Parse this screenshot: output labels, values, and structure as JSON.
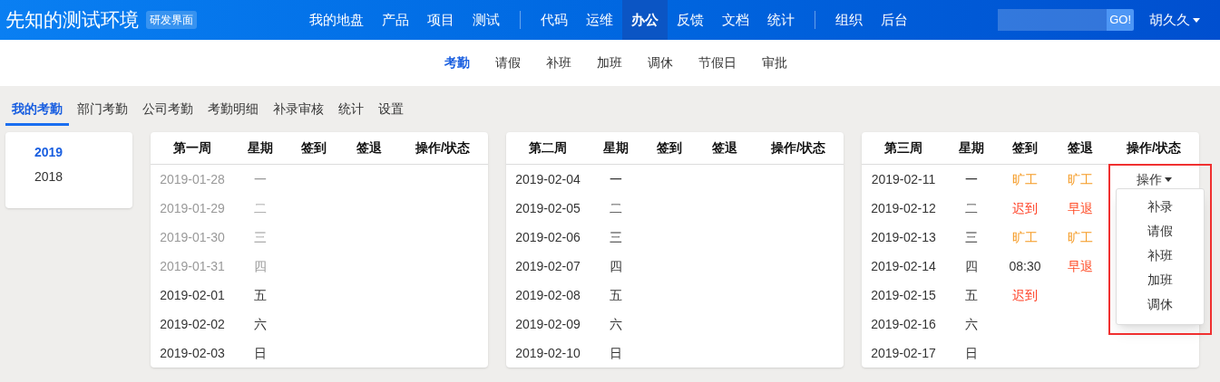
{
  "header": {
    "brand": "先知的测试环境",
    "badge": "研发界面",
    "nav_groups": [
      [
        {
          "label": "我的地盘",
          "selected": false
        },
        {
          "label": "产品",
          "selected": false
        },
        {
          "label": "项目",
          "selected": false
        },
        {
          "label": "测试",
          "selected": false
        }
      ],
      [
        {
          "label": "代码",
          "selected": false
        },
        {
          "label": "运维",
          "selected": false
        },
        {
          "label": "办公",
          "selected": true
        },
        {
          "label": "反馈",
          "selected": false
        },
        {
          "label": "文档",
          "selected": false
        },
        {
          "label": "统计",
          "selected": false
        }
      ],
      [
        {
          "label": "组织",
          "selected": false
        },
        {
          "label": "后台",
          "selected": false
        }
      ]
    ],
    "search_button": "GO!",
    "user": "胡久久"
  },
  "subnav": [
    {
      "label": "考勤",
      "selected": true
    },
    {
      "label": "请假",
      "selected": false
    },
    {
      "label": "补班",
      "selected": false
    },
    {
      "label": "加班",
      "selected": false
    },
    {
      "label": "调休",
      "selected": false
    },
    {
      "label": "节假日",
      "selected": false
    },
    {
      "label": "审批",
      "selected": false
    }
  ],
  "tabs": [
    {
      "label": "我的考勤",
      "selected": true
    },
    {
      "label": "部门考勤",
      "selected": false
    },
    {
      "label": "公司考勤",
      "selected": false
    },
    {
      "label": "考勤明细",
      "selected": false
    },
    {
      "label": "补录审核",
      "selected": false
    },
    {
      "label": "统计",
      "selected": false
    },
    {
      "label": "设置",
      "selected": false
    }
  ],
  "years": [
    {
      "label": "2019",
      "selected": true
    },
    {
      "label": "2018",
      "selected": false
    }
  ],
  "weeks": [
    {
      "columns": [
        "第一周",
        "星期",
        "签到",
        "签退",
        "操作/状态"
      ],
      "rows": [
        {
          "date": "2019-01-28",
          "weekday": "一",
          "muted": true
        },
        {
          "date": "2019-01-29",
          "weekday": "二",
          "muted": true
        },
        {
          "date": "2019-01-30",
          "weekday": "三",
          "muted": true
        },
        {
          "date": "2019-01-31",
          "weekday": "四",
          "muted": true
        },
        {
          "date": "2019-02-01",
          "weekday": "五",
          "muted": false
        },
        {
          "date": "2019-02-02",
          "weekday": "六",
          "muted": false
        },
        {
          "date": "2019-02-03",
          "weekday": "日",
          "muted": false
        }
      ]
    },
    {
      "columns": [
        "第二周",
        "星期",
        "签到",
        "签退",
        "操作/状态"
      ],
      "rows": [
        {
          "date": "2019-02-04",
          "weekday": "一",
          "muted": false
        },
        {
          "date": "2019-02-05",
          "weekday": "二",
          "muted": false
        },
        {
          "date": "2019-02-06",
          "weekday": "三",
          "muted": false
        },
        {
          "date": "2019-02-07",
          "weekday": "四",
          "muted": false
        },
        {
          "date": "2019-02-08",
          "weekday": "五",
          "muted": false
        },
        {
          "date": "2019-02-09",
          "weekday": "六",
          "muted": false
        },
        {
          "date": "2019-02-10",
          "weekday": "日",
          "muted": false
        }
      ]
    },
    {
      "columns": [
        "第三周",
        "星期",
        "签到",
        "签退",
        "操作/状态"
      ],
      "rows": [
        {
          "date": "2019-02-11",
          "weekday": "一",
          "muted": false,
          "check_in": {
            "text": "旷工",
            "kind": "absent"
          },
          "check_out": {
            "text": "旷工",
            "kind": "absent"
          },
          "action": {
            "label": "操作",
            "expanded": true,
            "highlighted": true,
            "menu": [
              "补录",
              "请假",
              "补班",
              "加班",
              "调休"
            ]
          }
        },
        {
          "date": "2019-02-12",
          "weekday": "二",
          "muted": false,
          "check_in": {
            "text": "迟到",
            "kind": "late"
          },
          "check_out": {
            "text": "早退",
            "kind": "early"
          }
        },
        {
          "date": "2019-02-13",
          "weekday": "三",
          "muted": false,
          "check_in": {
            "text": "旷工",
            "kind": "absent"
          },
          "check_out": {
            "text": "旷工",
            "kind": "absent"
          }
        },
        {
          "date": "2019-02-14",
          "weekday": "四",
          "muted": false,
          "check_in": {
            "text": "08:30",
            "kind": "time"
          },
          "check_out": {
            "text": "早退",
            "kind": "early"
          }
        },
        {
          "date": "2019-02-15",
          "weekday": "五",
          "muted": false,
          "check_in": {
            "text": "迟到",
            "kind": "late"
          }
        },
        {
          "date": "2019-02-16",
          "weekday": "六",
          "muted": false
        },
        {
          "date": "2019-02-17",
          "weekday": "日",
          "muted": false
        }
      ]
    }
  ]
}
